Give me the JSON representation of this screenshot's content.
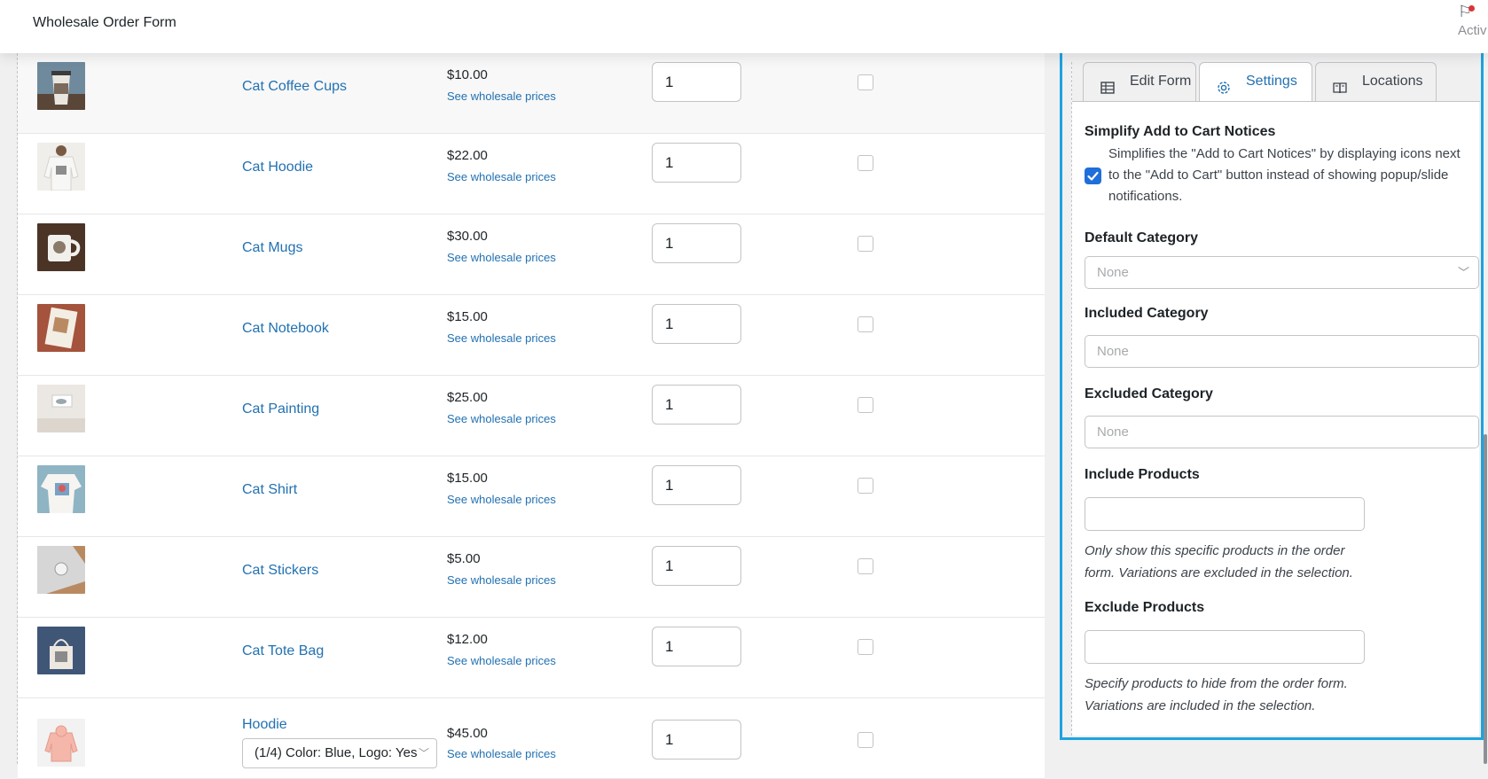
{
  "header": {
    "title": "Wholesale Order Form",
    "activity_label": "Activ"
  },
  "products": [
    {
      "name": "Cat Coffee Cups",
      "price": "$10.00",
      "wholesale_link": "See wholesale prices",
      "qty": "1",
      "thumb": "coffee-cup"
    },
    {
      "name": "Cat Hoodie",
      "price": "$22.00",
      "wholesale_link": "See wholesale prices",
      "qty": "1",
      "thumb": "hoodie"
    },
    {
      "name": "Cat Mugs",
      "price": "$30.00",
      "wholesale_link": "See wholesale prices",
      "qty": "1",
      "thumb": "mug"
    },
    {
      "name": "Cat Notebook",
      "price": "$15.00",
      "wholesale_link": "See wholesale prices",
      "qty": "1",
      "thumb": "notebook"
    },
    {
      "name": "Cat Painting",
      "price": "$25.00",
      "wholesale_link": "See wholesale prices",
      "qty": "1",
      "thumb": "painting"
    },
    {
      "name": "Cat Shirt",
      "price": "$15.00",
      "wholesale_link": "See wholesale prices",
      "qty": "1",
      "thumb": "shirt"
    },
    {
      "name": "Cat Stickers",
      "price": "$5.00",
      "wholesale_link": "See wholesale prices",
      "qty": "1",
      "thumb": "stickers"
    },
    {
      "name": "Cat Tote Bag",
      "price": "$12.00",
      "wholesale_link": "See wholesale prices",
      "qty": "1",
      "thumb": "tote"
    },
    {
      "name": "Hoodie",
      "price": "$45.00",
      "wholesale_link": "See wholesale prices",
      "qty": "1",
      "thumb": "hoodie-pink",
      "variation": "(1/4) Color: Blue, Logo: Yes"
    }
  ],
  "panel": {
    "tabs": [
      {
        "label": "Edit Form",
        "icon": "table-icon"
      },
      {
        "label": "Settings",
        "icon": "gear-icon"
      },
      {
        "label": "Locations",
        "icon": "book-icon"
      }
    ],
    "active_tab": "Settings",
    "simplify": {
      "heading": "Simplify Add to Cart Notices",
      "description": "Simplifies the \"Add to Cart Notices\" by displaying icons next to the \"Add to Cart\" button instead of showing popup/slide notifications.",
      "checked": true
    },
    "default_category": {
      "heading": "Default Category",
      "placeholder": "None"
    },
    "included_category": {
      "heading": "Included Category",
      "placeholder": "None"
    },
    "excluded_category": {
      "heading": "Excluded Category",
      "placeholder": "None"
    },
    "include_products": {
      "heading": "Include Products",
      "help": "Only show this specific products in the order form. Variations are excluded in the selection."
    },
    "exclude_products": {
      "heading": "Exclude Products",
      "help": "Specify products to hide from the order form. Variations are included in the selection."
    }
  },
  "colors": {
    "accent": "#1ea3df",
    "link": "#2271b1",
    "checkbox": "#1e6fd9"
  }
}
